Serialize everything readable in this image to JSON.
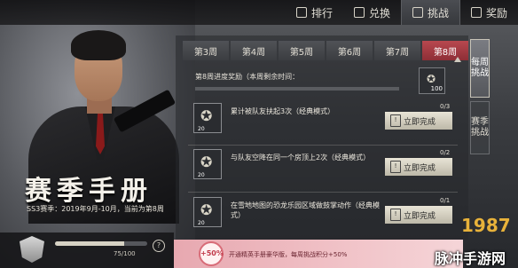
{
  "top_nav": [
    {
      "label": "排行",
      "icon": "ranking-icon",
      "active": false
    },
    {
      "label": "兑换",
      "icon": "exchange-icon",
      "active": false
    },
    {
      "label": "挑战",
      "icon": "trophy-icon",
      "active": true
    },
    {
      "label": "奖励",
      "icon": "gift-icon",
      "active": false
    }
  ],
  "season": {
    "title": "赛季手册",
    "subtitle": "SS3赛季：2019年9月-10月，当前为第8周"
  },
  "weeks": [
    {
      "label": "第3周",
      "selected": false
    },
    {
      "label": "第4周",
      "selected": false
    },
    {
      "label": "第5周",
      "selected": false
    },
    {
      "label": "第6周",
      "selected": false
    },
    {
      "label": "第7周",
      "selected": false
    },
    {
      "label": "第8周",
      "selected": true
    }
  ],
  "week_reward": {
    "label": "第8周进度奖励（本周剩余时间：",
    "amount": "100"
  },
  "tasks": [
    {
      "desc": "累计被队友扶起3次（经典模式）",
      "progress": "0/3",
      "points": "20",
      "button": "立即完成"
    },
    {
      "desc": "与队友空降在同一个房顶上2次（经典模式）",
      "progress": "0/2",
      "points": "20",
      "button": "立即完成"
    },
    {
      "desc": "在雪地地图的恐龙乐园区域做鼓掌动作（经典模式）",
      "progress": "0/1",
      "points": "20",
      "button": "立即完成"
    }
  ],
  "side_tabs": [
    {
      "label": "每周挑战",
      "active": true
    },
    {
      "label": "赛季挑战",
      "active": false
    }
  ],
  "level": {
    "progress_text": "75/100",
    "progress_fraction": 0.75,
    "help": "?"
  },
  "promo": {
    "badge": "+50%",
    "text": "开通精英手册豪华版，每周挑战积分+50%"
  },
  "watermark": {
    "logo": "1987",
    "text": "脉冲手游网"
  },
  "colors": {
    "selected_week": "#b8484f",
    "promo_bg": "#f1c3c8",
    "logo": "#e8b23a"
  }
}
